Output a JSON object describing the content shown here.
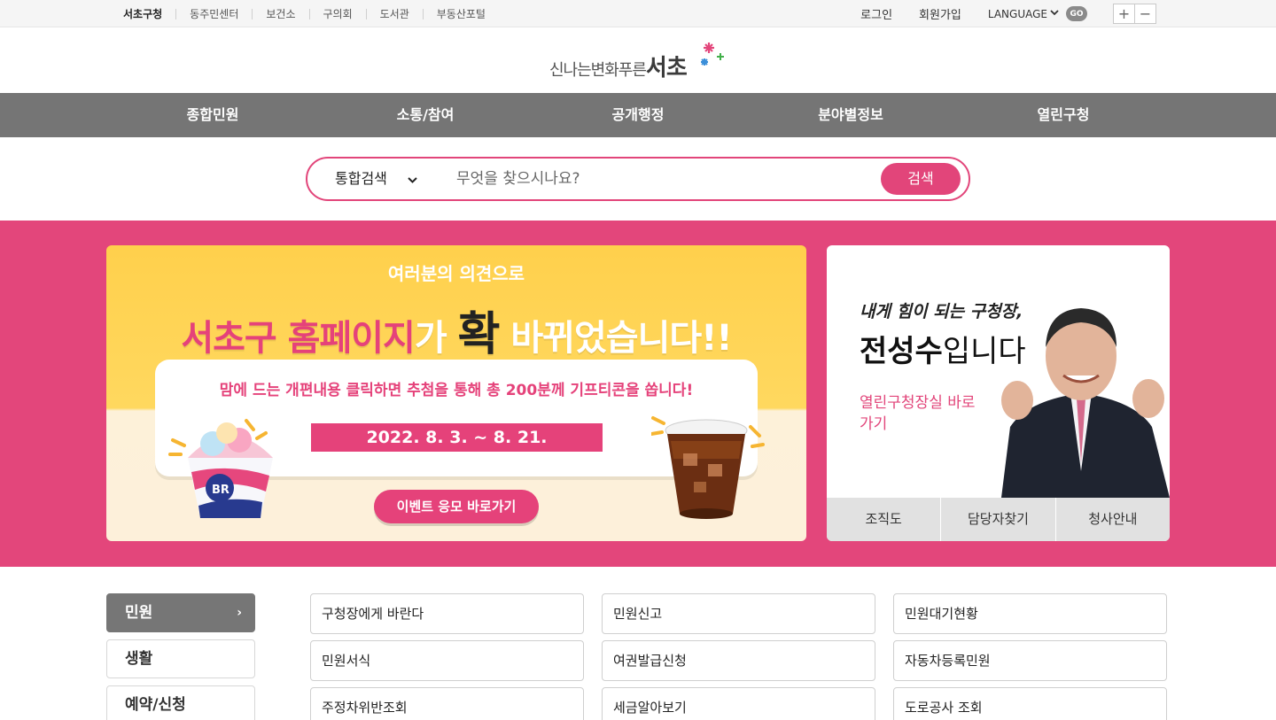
{
  "topbar": {
    "sites": [
      "서초구청",
      "동주민센터",
      "보건소",
      "구의회",
      "도서관",
      "부동산포털"
    ],
    "login": "로그인",
    "join": "회원가입",
    "language": "LANGUAGE",
    "go": "GO",
    "zoom_in": "+",
    "zoom_out": "−"
  },
  "logo": {
    "tagline": "신나는변화푸른",
    "name": "서초"
  },
  "gnb": [
    "종합민원",
    "소통/참여",
    "공개행정",
    "분야별정보",
    "열린구청"
  ],
  "search": {
    "category": "통합검색",
    "placeholder": "무엇을 찾으시나요?",
    "button": "검색"
  },
  "banner": {
    "subtitle": "여러분의 의견으로",
    "title_a": "서초구 홈페이지",
    "title_b": "가 ",
    "title_c": "확",
    "title_d": " 바뀌었습니다!!",
    "desc": "맘에 드는 개편내용 클릭하면 추첨을 통해  총 200분께 기프티콘을 쏩니다!",
    "date": "2022. 8. 3. ~ 8. 21.",
    "cta": "이벤트 응모 바로가기",
    "cup_logo": "BR"
  },
  "mayor": {
    "subtitle": "내게 힘이 되는 구청장,",
    "name": "전성수",
    "name_suffix": "입니다",
    "link": "열린구청장실 바로가기",
    "tabs": [
      "조직도",
      "담당자찾기",
      "청사안내"
    ]
  },
  "categories": [
    "민원",
    "생활",
    "예약/신청"
  ],
  "category_arrow": "›",
  "services": [
    [
      "구청장에게 바란다",
      "민원신고",
      "민원대기현황"
    ],
    [
      "민원서식",
      "여권발급신청",
      "자동차등록민원"
    ],
    [
      "주정차위반조회",
      "세금알아보기",
      "도로공사 조회"
    ]
  ],
  "colors": {
    "brand_pink": "#e3467b",
    "gnb_gray": "#757575",
    "banner_yellow": "#ffd04c"
  }
}
